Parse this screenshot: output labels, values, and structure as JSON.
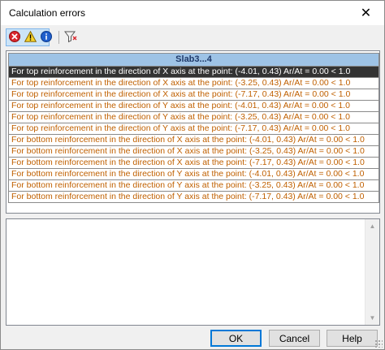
{
  "window": {
    "title": "Calculation errors",
    "close_glyph": "✕"
  },
  "toolbar": {
    "buttons": [
      {
        "name": "errors-filter",
        "icon": "error-icon",
        "selected": true
      },
      {
        "name": "warnings-filter",
        "icon": "warning-icon",
        "selected": true
      },
      {
        "name": "info-filter",
        "icon": "info-icon",
        "selected": true
      },
      {
        "name": "filter",
        "icon": "filter-icon",
        "selected": false
      }
    ]
  },
  "list": {
    "header": "Slab3...4",
    "rows": [
      {
        "text": "For top reinforcement in the direction of X axis at the point: (-4.01, 0.43) Ar/At = 0.00 < 1.0",
        "selected": true
      },
      {
        "text": "For top reinforcement in the direction of X axis at the point: (-3.25, 0.43) Ar/At = 0.00 < 1.0",
        "selected": false
      },
      {
        "text": "For top reinforcement in the direction of X axis at the point: (-7.17, 0.43) Ar/At = 0.00 < 1.0",
        "selected": false
      },
      {
        "text": "For top reinforcement in the direction of Y axis at the point: (-4.01, 0.43) Ar/At = 0.00 < 1.0",
        "selected": false
      },
      {
        "text": "For top reinforcement in the direction of Y axis at the point: (-3.25, 0.43) Ar/At = 0.00 < 1.0",
        "selected": false
      },
      {
        "text": "For top reinforcement in the direction of Y axis at the point: (-7.17, 0.43) Ar/At = 0.00 < 1.0",
        "selected": false
      },
      {
        "text": "For bottom reinforcement in the direction of X axis at the point: (-4.01, 0.43) Ar/At = 0.00 < 1.0",
        "selected": false
      },
      {
        "text": "For bottom reinforcement in the direction of X axis at the point: (-3.25, 0.43) Ar/At = 0.00 < 1.0",
        "selected": false
      },
      {
        "text": "For bottom reinforcement in the direction of X axis at the point: (-7.17, 0.43) Ar/At = 0.00 < 1.0",
        "selected": false
      },
      {
        "text": "For bottom reinforcement in the direction of Y axis at the point: (-4.01, 0.43) Ar/At = 0.00 < 1.0",
        "selected": false
      },
      {
        "text": "For bottom reinforcement in the direction of Y axis at the point: (-3.25, 0.43) Ar/At = 0.00 < 1.0",
        "selected": false
      },
      {
        "text": "For bottom reinforcement in the direction of Y axis at the point: (-7.17, 0.43) Ar/At = 0.00 < 1.0",
        "selected": false
      }
    ]
  },
  "detail": {
    "text": ""
  },
  "footer": {
    "ok_label": "OK",
    "cancel_label": "Cancel",
    "help_label": "Help"
  },
  "colors": {
    "row_text": "#c06000",
    "header_bg": "#9ec3e6",
    "selected_bg": "#333333",
    "default_button_border": "#0078d7"
  }
}
